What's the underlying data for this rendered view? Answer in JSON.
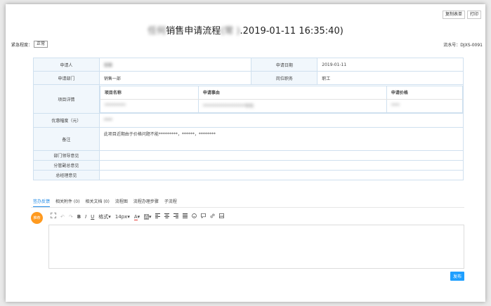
{
  "top_buttons": [
    "复制表单",
    "打印"
  ],
  "title": {
    "blurred_prefix": "任何",
    "main": "销售申请流程",
    "blurred_mid": "(常 )",
    "datetime": ".2019-01-11 16:35:40)"
  },
  "urgency": {
    "label": "紧急程度：",
    "value": "正常"
  },
  "serial": "流水号：DJXS-0091",
  "form": {
    "applicant_label": "申请人",
    "applicant_value": "常事",
    "apply_date_label": "申请日期",
    "apply_date_value": "2019-01-11",
    "dept_label": "申请部门",
    "dept_value": "销售一部",
    "position_label": "岗位职务",
    "position_value": "职工",
    "project_label": "项目详情",
    "project_headers": [
      "项目名称",
      "申请事由",
      "申请价格"
    ],
    "project_row": [
      "**********",
      "********************年利",
      "****"
    ],
    "discount_label": "优惠幅度（元）",
    "discount_value": "****",
    "remark_label": "备注",
    "remark_value": "此项目近期由于价格问题不能*********，******，********",
    "dept_leader_label": "部门领导意见",
    "vp_label": "分管副总意见",
    "gm_label": "总经理意见"
  },
  "tabs": [
    "签办反馈",
    "相关附件 (0)",
    "相关文档 (0)",
    "流程图",
    "流程办理步骤",
    "子流程"
  ],
  "avatar_text": "推荐",
  "toolbar": {
    "fullscreen_icon": "fullscreen-icon",
    "undo_icon": "undo-icon",
    "redo_icon": "redo-icon",
    "bold": "B",
    "italic": "I",
    "underline": "U",
    "format": "格式",
    "fontsize": "14px",
    "font_color": "A",
    "bg_color": "A",
    "icons": [
      "align-left-icon",
      "align-center-icon",
      "align-right-icon",
      "align-justify-icon",
      "emoji-icon",
      "comment-icon",
      "link-icon",
      "image-icon"
    ]
  },
  "publish_label": "发布"
}
